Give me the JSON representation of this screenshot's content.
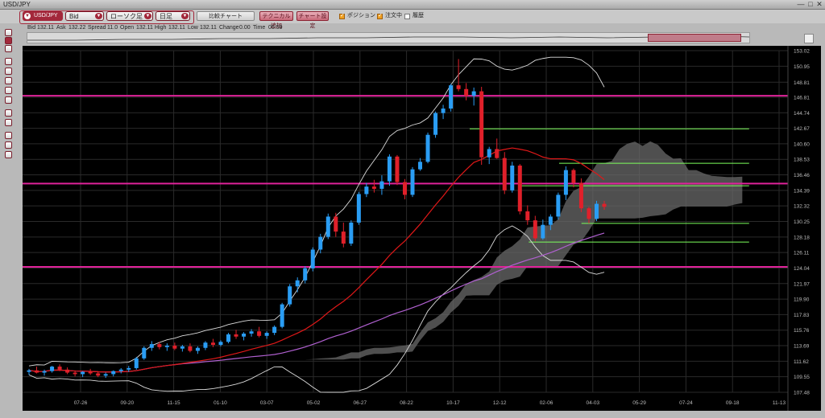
{
  "window": {
    "title": "USD/JPY",
    "minimize": "—",
    "maximize": "□",
    "close": "✕"
  },
  "toolbar": {
    "symbol": "USD/JPY",
    "price_type": "Bid",
    "chart_type": "ローソク足",
    "period": "日足",
    "compare_chart": "比較チャート",
    "add_technical": "テクニカル追加",
    "chart_settings": "チャート設定",
    "checks": [
      {
        "label": "ポジション",
        "checked": true
      },
      {
        "label": "注文中",
        "checked": true
      },
      {
        "label": "履歴",
        "checked": false
      }
    ]
  },
  "info": {
    "bid_label": "Bid",
    "bid": "132.11",
    "ask_label": "Ask",
    "ask": "132.22",
    "spread_label": "Spread",
    "spread": "11.0",
    "open_label": "Open",
    "open": "132.11",
    "high_label": "High",
    "high": "132.11",
    "low_label": "Low",
    "low": "132.11",
    "change_label": "Change",
    "change": "0.00",
    "time_label": "Time",
    "time": "05:59"
  },
  "chart_data": {
    "type": "candlestick",
    "y_ticks": [
      "153.02",
      "150.95",
      "148.81",
      "146.81",
      "144.74",
      "142.67",
      "140.60",
      "138.53",
      "136.46",
      "134.39",
      "132.32",
      "130.25",
      "128.18",
      "126.11",
      "124.04",
      "121.97",
      "119.90",
      "117.83",
      "115.76",
      "113.69",
      "111.62",
      "109.55",
      "107.48"
    ],
    "ylim": [
      107.48,
      153.02
    ],
    "x_ticks": [
      "07-26",
      "09-20",
      "11-15",
      "01-10",
      "03-07",
      "05-02",
      "06-27",
      "08-22",
      "10-17",
      "12-12",
      "02-06",
      "04-03",
      "05-29",
      "07-24",
      "09-18",
      "11-13"
    ],
    "candles": [
      [
        110.2,
        110.6,
        109.8,
        110.4
      ],
      [
        110.4,
        110.9,
        110.0,
        110.1
      ],
      [
        110.1,
        110.5,
        109.7,
        110.3
      ],
      [
        110.3,
        111.0,
        110.1,
        110.9
      ],
      [
        110.9,
        111.2,
        110.3,
        110.5
      ],
      [
        110.5,
        110.8,
        109.9,
        110.1
      ],
      [
        110.1,
        110.4,
        109.6,
        109.9
      ],
      [
        109.9,
        110.3,
        109.5,
        110.2
      ],
      [
        110.2,
        110.6,
        109.8,
        110.0
      ],
      [
        110.0,
        110.3,
        109.5,
        109.7
      ],
      [
        109.7,
        110.1,
        109.4,
        109.9
      ],
      [
        109.9,
        110.4,
        109.6,
        110.3
      ],
      [
        110.3,
        110.7,
        110.0,
        110.5
      ],
      [
        110.5,
        111.0,
        110.2,
        110.7
      ],
      [
        110.7,
        112.2,
        110.5,
        112.0
      ],
      [
        112.0,
        113.6,
        111.8,
        113.4
      ],
      [
        113.4,
        114.3,
        113.0,
        113.9
      ],
      [
        113.9,
        114.2,
        113.2,
        113.5
      ],
      [
        113.5,
        114.0,
        113.0,
        113.7
      ],
      [
        113.7,
        114.1,
        113.1,
        113.3
      ],
      [
        113.3,
        113.8,
        112.9,
        113.6
      ],
      [
        113.6,
        114.0,
        112.8,
        113.0
      ],
      [
        113.0,
        113.6,
        112.6,
        113.4
      ],
      [
        113.4,
        114.3,
        113.1,
        114.1
      ],
      [
        114.1,
        114.6,
        113.5,
        113.8
      ],
      [
        113.8,
        114.4,
        113.6,
        114.2
      ],
      [
        114.2,
        115.4,
        114.0,
        115.2
      ],
      [
        115.2,
        115.8,
        114.6,
        114.9
      ],
      [
        114.9,
        115.5,
        114.4,
        115.3
      ],
      [
        115.3,
        115.9,
        114.9,
        115.6
      ],
      [
        115.6,
        116.2,
        114.8,
        115.0
      ],
      [
        115.0,
        115.6,
        114.6,
        115.4
      ],
      [
        115.4,
        116.4,
        115.1,
        116.2
      ],
      [
        116.2,
        119.4,
        116.0,
        119.2
      ],
      [
        119.2,
        121.9,
        118.9,
        121.6
      ],
      [
        121.6,
        122.8,
        120.8,
        122.4
      ],
      [
        122.4,
        124.3,
        122.0,
        124.0
      ],
      [
        124.0,
        126.8,
        123.6,
        126.5
      ],
      [
        126.5,
        128.6,
        126.0,
        128.2
      ],
      [
        128.2,
        131.3,
        127.9,
        130.9
      ],
      [
        130.9,
        131.4,
        128.2,
        128.9
      ],
      [
        128.9,
        130.1,
        126.8,
        127.3
      ],
      [
        127.3,
        130.4,
        127.0,
        130.1
      ],
      [
        130.1,
        134.2,
        129.8,
        133.9
      ],
      [
        133.9,
        135.4,
        133.5,
        134.9
      ],
      [
        134.9,
        135.8,
        134.1,
        134.6
      ],
      [
        134.6,
        136.4,
        133.8,
        135.6
      ],
      [
        135.6,
        139.2,
        135.0,
        138.9
      ],
      [
        138.9,
        139.1,
        135.1,
        135.5
      ],
      [
        135.5,
        135.9,
        133.2,
        133.8
      ],
      [
        133.8,
        137.5,
        133.5,
        137.2
      ],
      [
        137.2,
        138.7,
        137.0,
        138.2
      ],
      [
        138.2,
        142.1,
        138.0,
        141.8
      ],
      [
        141.8,
        144.9,
        141.4,
        144.7
      ],
      [
        144.7,
        145.8,
        143.9,
        145.3
      ],
      [
        145.3,
        148.6,
        144.9,
        148.4
      ],
      [
        148.4,
        151.9,
        147.6,
        147.9
      ],
      [
        147.9,
        148.7,
        146.4,
        147.0
      ],
      [
        147.0,
        148.1,
        145.7,
        147.6
      ],
      [
        147.6,
        148.2,
        137.8,
        138.8
      ],
      [
        138.8,
        140.2,
        137.9,
        139.9
      ],
      [
        139.9,
        141.3,
        138.6,
        138.7
      ],
      [
        138.7,
        139.5,
        133.9,
        134.4
      ],
      [
        134.4,
        138.2,
        134.1,
        137.7
      ],
      [
        137.7,
        137.9,
        131.2,
        131.6
      ],
      [
        131.6,
        132.4,
        129.8,
        130.4
      ],
      [
        130.4,
        131.0,
        127.6,
        128.0
      ],
      [
        128.0,
        130.5,
        127.8,
        129.8
      ],
      [
        129.8,
        131.2,
        129.1,
        130.9
      ],
      [
        130.9,
        134.1,
        130.5,
        133.8
      ],
      [
        133.8,
        137.6,
        133.1,
        137.1
      ],
      [
        137.1,
        137.3,
        134.8,
        135.4
      ],
      [
        135.4,
        136.0,
        131.5,
        132.0
      ],
      [
        132.0,
        132.2,
        130.0,
        130.6
      ],
      [
        130.6,
        133.0,
        130.3,
        132.6
      ],
      [
        132.6,
        133.0,
        131.8,
        132.2
      ]
    ],
    "horizontal_lines": [
      147.0,
      135.3,
      124.2
    ],
    "order_lines": [
      {
        "y": 142.6,
        "x0": 0.56,
        "x1": 0.91
      },
      {
        "y": 138.0,
        "x0": 0.672,
        "x1": 0.91
      },
      {
        "y": 135.0,
        "x0": 0.622,
        "x1": 0.91
      },
      {
        "y": 130.0,
        "x0": 0.7,
        "x1": 0.91
      },
      {
        "y": 127.5,
        "x0": 0.634,
        "x1": 0.91
      }
    ],
    "colors": {
      "up": "#2a9df4",
      "down": "#e0202a",
      "ma_short": "#e01818",
      "ma_long": "#b060d0",
      "bands": "#dcdcdc",
      "cloud": "#6a6a6a",
      "hline": "#e0229a",
      "order": "#7cff5c"
    }
  }
}
